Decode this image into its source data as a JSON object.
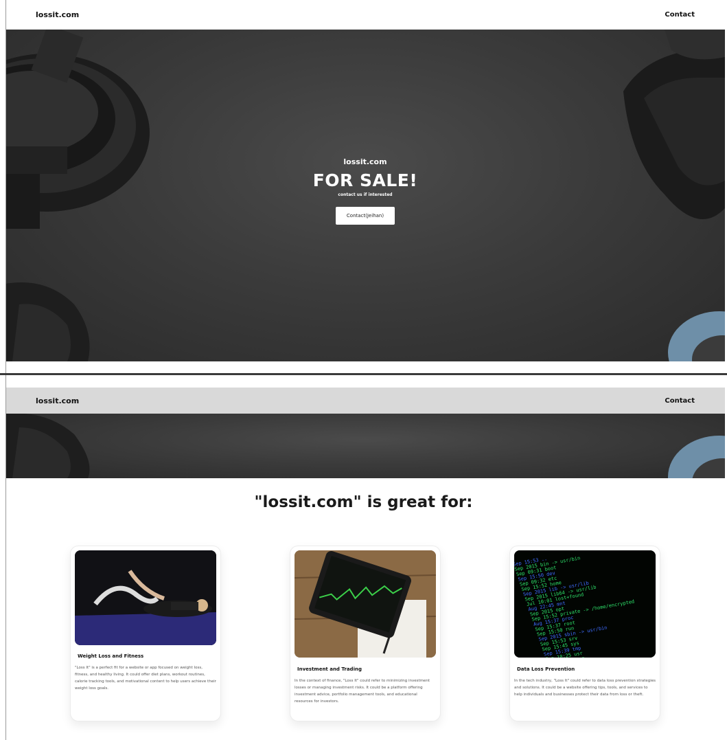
{
  "nav": {
    "brand": "lossit.com",
    "contact": "Contact"
  },
  "hero": {
    "domain": "lossit.com",
    "title": "FOR SALE!",
    "subtitle": "contact us if interested",
    "button": "Contact(Jeihan)"
  },
  "section": {
    "title": "\"lossit.com\" is great for:"
  },
  "cards": [
    {
      "title": "Weight Loss and Fitness",
      "text": "\"Loss It\" is a perfect fit for a website or app focused on weight loss, fitness, and healthy living. It could offer diet plans, workout routines, calorie tracking tools, and motivational content to help users achieve their weight loss goals."
    },
    {
      "title": "Investment and Trading",
      "text": "In the context of finance, \"Loss It\" could refer to minimizing investment losses or managing investment risks. It could be a platform offering investment advice, portfolio management tools, and educational resources for investors."
    },
    {
      "title": "Data Loss Prevention",
      "text": "In the tech industry, \"Loss It\" could refer to data loss prevention strategies and solutions. It could be a website offering tips, tools, and services to help individuals and businesses protect their data from loss or theft."
    }
  ],
  "terminal_lines": [
    "Sep 15:53 ..",
    "Sep 2015  bin -> usr/bin",
    "Sep 09:31 boot",
    "Sep 15:50 dev",
    "Sep 09:32 etc",
    "Sep 15:52 home",
    "Sep 2015  lib -> usr/lib",
    "Sep 2015  lib64 -> usr/lib",
    "Jul 10:01 lost+found",
    "Aug 22:45 mnt",
    "Sep 2015  opt",
    "Sep 15:52 private -> /home/encrypted",
    "Aug 15:37 proc",
    "Sep 15:37 root",
    "Sep 15:50 run",
    "Sep 2015  sbin -> usr/bin",
    "Sep 15:53 srv",
    "Sep 15:45 sys",
    "Sep 15:39 tmp",
    "Sep 10:25 usr",
    "Sep 10:25 var"
  ],
  "colors": {
    "hero_bg": "#3b3b3b",
    "nav_bottom_bg": "#d9d9d9",
    "terminal_green": "#2ee06a",
    "terminal_blue": "#3f6cff"
  }
}
